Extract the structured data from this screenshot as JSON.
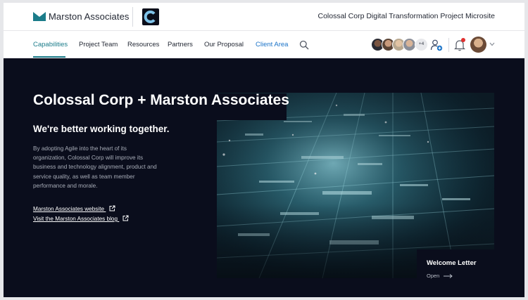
{
  "header": {
    "brand_name": "Marston Associates",
    "site_title": "Colossal Corp Digital Transformation Project Microsite"
  },
  "nav": {
    "items": [
      {
        "label": "Capabilities",
        "active": true
      },
      {
        "label": "Project Team"
      },
      {
        "label": "Resources"
      },
      {
        "label": "Partners"
      },
      {
        "label": "Our Proposal"
      },
      {
        "label": "Client Area"
      }
    ],
    "more_members": "+4"
  },
  "hero": {
    "title": "Colossal Corp + Marston Associates",
    "subtitle": "We're better working together.",
    "body": "By adopting Agile into the heart of its organization, Colossal Corp will improve its business and technology alignment, product and service quality, as well as team member performance and morale.",
    "links": [
      {
        "label": "Marston Associates website"
      },
      {
        "label": "Visit the Marston Associates blog"
      }
    ],
    "welcome": {
      "title": "Welcome Letter",
      "action": "Open"
    }
  },
  "colors": {
    "accent": "#1b7c8a",
    "client_link": "#1a73c8",
    "hero_bg": "#0a0d1c",
    "notification": "#e0302f"
  },
  "icons": [
    "marston-logo-icon",
    "colossal-logo-icon",
    "search-icon",
    "add-user-icon",
    "bell-icon",
    "chevron-down-icon",
    "external-link-icon",
    "arrow-right-icon"
  ]
}
